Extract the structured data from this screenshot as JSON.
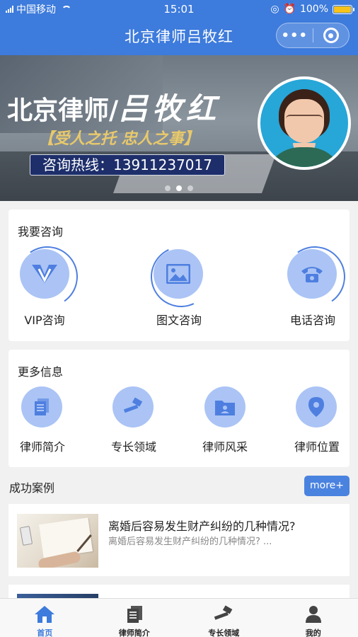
{
  "status_bar": {
    "carrier": "中国移动",
    "time": "15:01",
    "battery": "100%",
    "battery_level": 1.0
  },
  "nav": {
    "title": "北京律师吕牧红",
    "more_icon": "more-dots-icon",
    "close_icon": "target-icon"
  },
  "banner": {
    "title_prefix": "北京律师/",
    "title_name": "吕牧红",
    "slogan": "【受人之托 忠人之事】",
    "hotline": "咨询热线：13911237017",
    "indicator_count": 3,
    "active_indicator": 2
  },
  "consult": {
    "title": "我要咨询",
    "items": [
      {
        "label": "VIP咨询",
        "icon": "vip-icon"
      },
      {
        "label": "图文咨询",
        "icon": "image-icon"
      },
      {
        "label": "电话咨询",
        "icon": "phone-icon"
      }
    ]
  },
  "more_info": {
    "title": "更多信息",
    "items": [
      {
        "label": "律师简介",
        "icon": "document-icon"
      },
      {
        "label": "专长领域",
        "icon": "gavel-icon"
      },
      {
        "label": "律师风采",
        "icon": "folder-person-icon"
      },
      {
        "label": "律师位置",
        "icon": "location-pin-icon"
      }
    ]
  },
  "cases": {
    "title": "成功案例",
    "more_label": "more+",
    "items": [
      {
        "title": "离婚后容易发生财产纠纷的几种情况?",
        "summary": "离婚后容易发生财产纠纷的几种情况? ..."
      }
    ]
  },
  "tabbar": {
    "items": [
      {
        "label": "首页",
        "icon": "home-icon",
        "active": true
      },
      {
        "label": "律师简介",
        "icon": "document-icon",
        "active": false
      },
      {
        "label": "专长领域",
        "icon": "gavel-icon",
        "active": false
      },
      {
        "label": "我的",
        "icon": "user-icon",
        "active": false
      }
    ]
  },
  "colors": {
    "brand_blue": "#3d7bdc",
    "icon_bg": "#abc4f5",
    "icon_fg": "#4e7fe0",
    "battery_fill": "#f7c31a",
    "hotline_bg": "#1d2e6a",
    "slogan_gold": "#e8c96b"
  }
}
